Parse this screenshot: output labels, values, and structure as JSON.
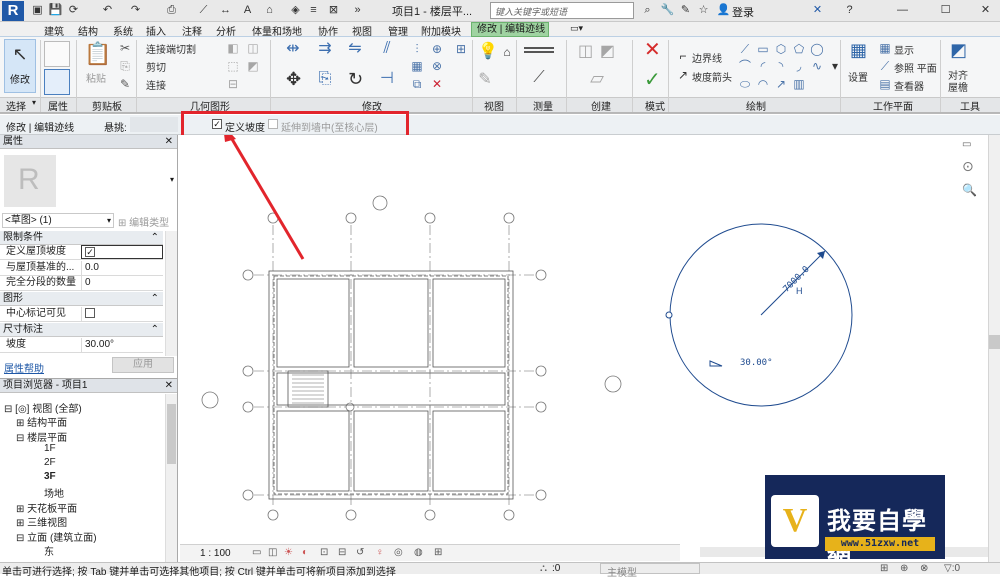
{
  "app": {
    "logo_letter": "R",
    "doc_title": "项目1 - 楼层平...",
    "search_placeholder": "键入关键字或短语",
    "login": "登录"
  },
  "menu_tabs": [
    "建筑",
    "结构",
    "系统",
    "插入",
    "注释",
    "分析",
    "体量和场地",
    "协作",
    "视图",
    "管理",
    "附加模块",
    "修改 | 编辑迹线"
  ],
  "ribbon": {
    "modify_label": "修改",
    "paste_label": "粘贴",
    "join_label": "连接端切割",
    "cut_label": "剪切",
    "connect_label": "连接",
    "boundary_label": "边界线",
    "slope_arrow_label": "坡度箭头",
    "set_label": "设置",
    "show_label": "显示",
    "ref_plane_label": "参照 平面",
    "viewer_label": "查看器",
    "align_label": "对齐",
    "roof_label": "屋檐",
    "panels": [
      "选择",
      "属性",
      "剪贴板",
      "几何图形",
      "修改",
      "视图",
      "测量",
      "创建",
      "模式",
      "绘制",
      "工作平面",
      "工具"
    ]
  },
  "options_bar": {
    "context": "修改 | 编辑迹线",
    "overhang_label": "悬挑:",
    "define_slope_label": "定义坡度",
    "define_slope_checked": true,
    "extend_label": "延伸到墙中(至核心层)",
    "extend_checked": false
  },
  "properties": {
    "title": "属性",
    "type_selector": "<草图> (1)",
    "edit_type": "编辑类型",
    "sections": {
      "constraints": "限制条件",
      "graphics": "图形",
      "dimensions": "尺寸标注"
    },
    "rows": {
      "define_roof_slope": "定义屋顶坡度",
      "offset_label": "与屋顶基准的...",
      "offset_value": "0.0",
      "full_segments_label": "完全分段的数量",
      "full_segments_value": "0",
      "center_mark_label": "中心标记可见",
      "slope_label": "坡度",
      "slope_value": "30.00°"
    },
    "help_link": "属性帮助",
    "apply_button": "应用"
  },
  "browser": {
    "title": "项目浏览器 - 项目1",
    "items": [
      "视图 (全部)",
      "结构平面",
      "楼层平面",
      "1F",
      "2F",
      "3F",
      "场地",
      "天花板平面",
      "三维视图",
      "立面 (建筑立面)",
      "东"
    ]
  },
  "canvas": {
    "dim_text": "7000.0",
    "angle_text": "30.00°",
    "scale": "1 : 100"
  },
  "watermark": {
    "name": "我要自學網",
    "url": "www.51zxw.net"
  },
  "status": {
    "hint": "单击可进行选择; 按 Tab 键并单击可选择其他项目; 按 Ctrl 键并单击可将新项目添加到选择",
    "workset_value": ":0",
    "model": "主模型"
  }
}
